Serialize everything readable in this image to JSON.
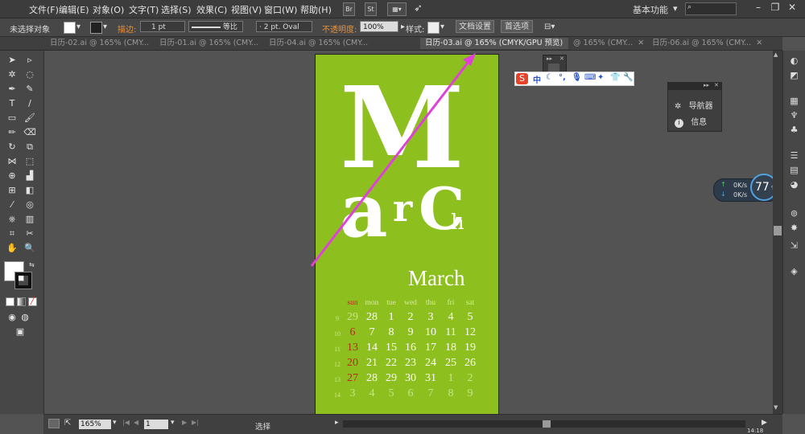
{
  "menubar": {
    "items": [
      "文件(F)",
      "编辑(E)",
      "对象(O)",
      "文字(T)",
      "选择(S)",
      "效果(C)",
      "视图(V)",
      "窗口(W)",
      "帮助(H)"
    ],
    "bridge_label": "Br",
    "stock_label": "St",
    "workspace": "基本功能",
    "window_controls": [
      "–",
      "❐",
      "✕"
    ]
  },
  "controlbar": {
    "selection_status": "未选择对象",
    "stroke_label": "描边:",
    "stroke_weight": "1 pt",
    "stroke_profile": "等比",
    "brush": "2 pt. Oval",
    "opacity_label": "不透明度:",
    "opacity_value": "100%",
    "style_label": "样式:",
    "doc_setup_button": "文档设置",
    "preferences_button": "首选项"
  },
  "tabs": [
    {
      "label": "日历-02.ai @ 165% (CMY...",
      "active": false
    },
    {
      "label": "日历-01.ai @ 165% (CMY...",
      "active": false
    },
    {
      "label": "日历-04.ai @ 165% (CMY...",
      "active": false
    },
    {
      "label": "日历-03.ai @ 165% (CMYK/GPU 预览)",
      "active": true
    },
    {
      "label": "@ 165% (CMY...",
      "active": false
    },
    {
      "label": "日历-06.ai @ 165% (CMY...",
      "active": false
    }
  ],
  "artwork": {
    "big_letters": {
      "m": "M",
      "a": "a",
      "r": "r",
      "c": "C",
      "h": "h"
    },
    "month": "March",
    "day_headers": [
      "sun",
      "mon",
      "tue",
      "wed",
      "thu",
      "fri",
      "sat"
    ],
    "week_numbers": [
      "9",
      "10",
      "11",
      "12",
      "13",
      "14"
    ],
    "rows": [
      [
        "29",
        "28",
        "1",
        "2",
        "3",
        "4",
        "5"
      ],
      [
        "6",
        "7",
        "8",
        "9",
        "10",
        "11",
        "12"
      ],
      [
        "13",
        "14",
        "15",
        "16",
        "17",
        "18",
        "19"
      ],
      [
        "20",
        "21",
        "22",
        "23",
        "24",
        "25",
        "26"
      ],
      [
        "27",
        "28",
        "29",
        "30",
        "31",
        "1",
        "2"
      ],
      [
        "3",
        "4",
        "5",
        "6",
        "7",
        "8",
        "9"
      ]
    ],
    "colors": {
      "background": "#8dbf1f",
      "sunday": "#b52c1a",
      "arrow": "#e040d8"
    }
  },
  "navigator_panel": {
    "items": [
      {
        "icon": "navigator-icon",
        "label": "导航器"
      },
      {
        "icon": "info-icon",
        "label": "信息"
      }
    ]
  },
  "ime": {
    "mode": "中"
  },
  "system_widget": {
    "upload": "0K/s",
    "download": "0K/s",
    "cpu": "77",
    "cpu_unit": "%"
  },
  "statusbar": {
    "zoom": "165%",
    "page": "1",
    "tool_status": "选择"
  },
  "clock_partial": "14:18"
}
